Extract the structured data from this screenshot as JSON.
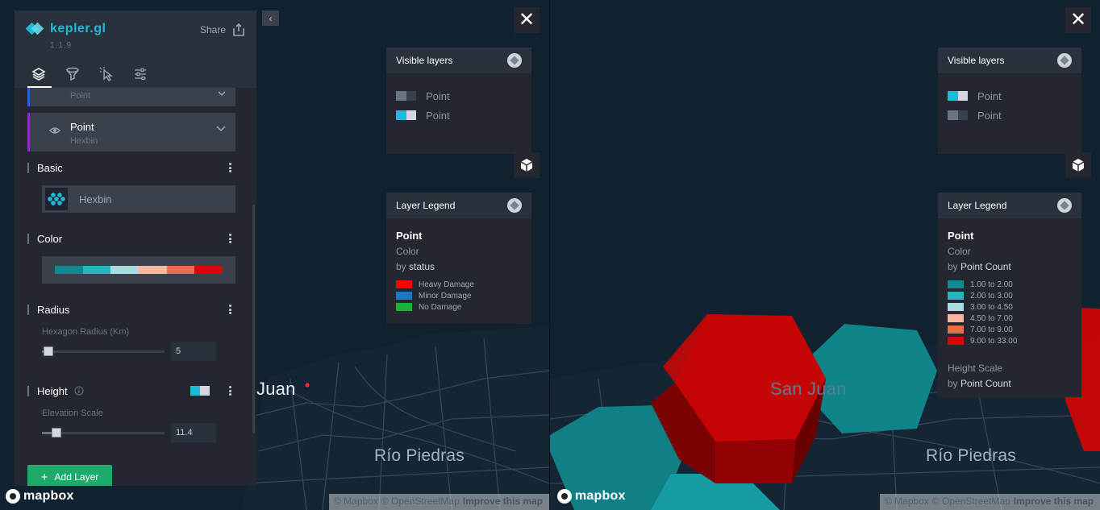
{
  "app": {
    "name": "kepler.gl",
    "version": "1.1.9",
    "share_label": "Share"
  },
  "sidebar": {
    "tabs": [
      "layers-icon",
      "filter-icon",
      "interaction-icon",
      "map-settings-icon"
    ],
    "active_tab": "layers",
    "layers": [
      {
        "title": "",
        "subtitle": "Point",
        "accent": "#2b62d9"
      },
      {
        "title": "Point",
        "subtitle": "Hexbin",
        "accent": "#8b2fc9"
      }
    ],
    "basic": {
      "title": "Basic",
      "layer_type": "Hexbin"
    },
    "color": {
      "title": "Color",
      "ramp": [
        "#0e8a91",
        "#29b4c0",
        "#a7dde1",
        "#f8b79d",
        "#ea6e4a",
        "#d9050a"
      ]
    },
    "radius": {
      "title": "Radius",
      "field_label": "Hexagon Radius (Km)",
      "value": "5",
      "slider_fraction": 0.0
    },
    "height": {
      "title": "Height",
      "field_label": "Elevation Scale",
      "value": "11.4",
      "slider_fraction": 0.11
    },
    "add_layer_label": "Add Layer"
  },
  "map_left": {
    "labels": {
      "city": "Juan",
      "district": "Río Piedras"
    },
    "visible_layers": {
      "title": "Visible layers",
      "items": [
        {
          "label": "Point",
          "swatch": [
            "#6a7485",
            "#3a414c"
          ]
        },
        {
          "label": "Point",
          "swatch": [
            "#1fbad6",
            "#d3d8e0"
          ]
        }
      ]
    },
    "legend": {
      "title": "Layer Legend",
      "layer": "Point",
      "channel": "Color",
      "by_prefix": "by",
      "by_field": "status",
      "items": [
        {
          "label": "Heavy Damage",
          "color": "#ff0000"
        },
        {
          "label": "Minor Damage",
          "color": "#1879c9"
        },
        {
          "label": "No Damage",
          "color": "#14b53a"
        }
      ]
    },
    "attribution": {
      "mapbox": "© Mapbox",
      "osm": "© OpenStreetMap",
      "improve": "Improve this map"
    },
    "logo": "mapbox"
  },
  "map_right": {
    "labels": {
      "city": "San Juan",
      "district": "Río Piedras"
    },
    "visible_layers": {
      "title": "Visible layers",
      "items": [
        {
          "label": "Point",
          "swatch": [
            "#1fbad6",
            "#d3d8e0"
          ]
        },
        {
          "label": "Point",
          "swatch": [
            "#6a7485",
            "#3a414c"
          ]
        }
      ]
    },
    "legend": {
      "title": "Layer Legend",
      "layer": "Point",
      "channel": "Color",
      "by_prefix": "by",
      "by_field": "Point Count",
      "items": [
        {
          "label": "1.00 to 2.00",
          "color": "#0e8a91"
        },
        {
          "label": "2.00 to 3.00",
          "color": "#29b4c0"
        },
        {
          "label": "3.00 to 4.50",
          "color": "#a7dde1"
        },
        {
          "label": "4.50 to 7.00",
          "color": "#f8b79d"
        },
        {
          "label": "7.00 to 9.00",
          "color": "#ea6e4a"
        },
        {
          "label": "9.00 to 33.00",
          "color": "#d9050a"
        }
      ],
      "height_label": "Height Scale",
      "height_by_field": "Point Count"
    },
    "attribution": {
      "mapbox": "© Mapbox",
      "osm": "© OpenStreetMap",
      "improve": "Improve this map"
    },
    "logo": "mapbox"
  },
  "icons": {
    "close": "✕",
    "plus": "+",
    "collapse": "‹"
  }
}
